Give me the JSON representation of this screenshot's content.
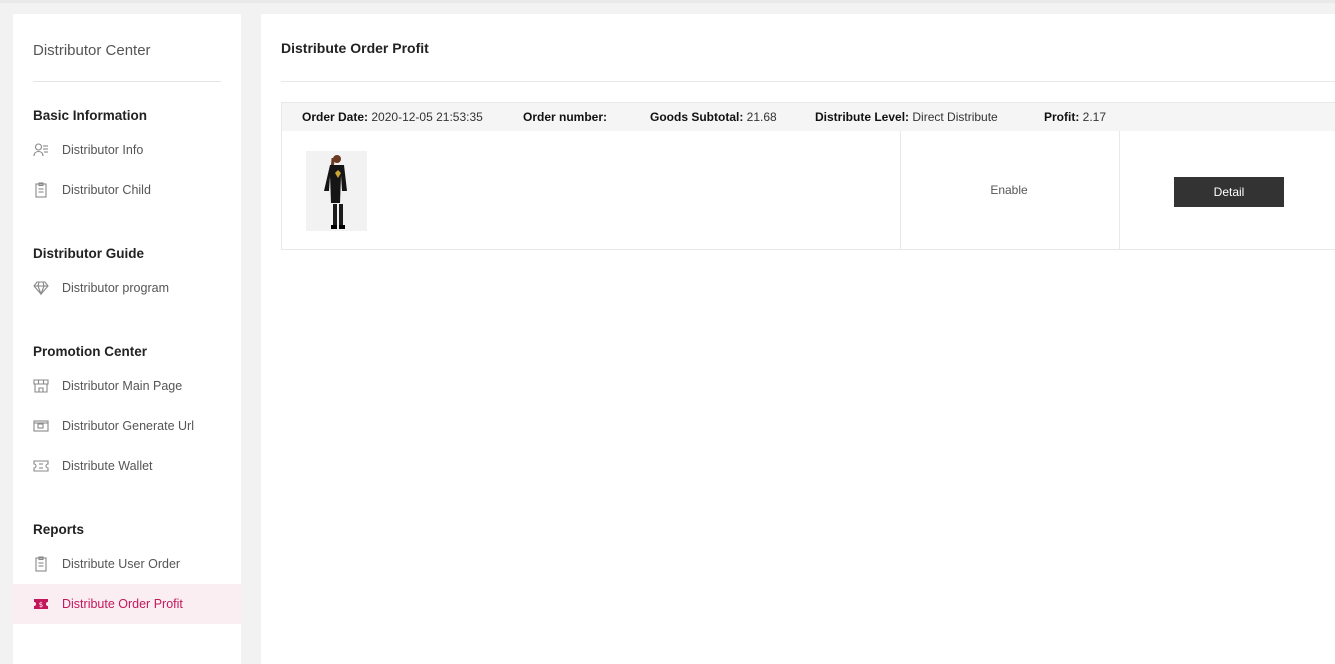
{
  "sidebar": {
    "title": "Distributor Center",
    "groups": [
      {
        "title": "Basic Information",
        "items": [
          {
            "label": "Distributor Info",
            "icon": "user-list-icon"
          },
          {
            "label": "Distributor Child",
            "icon": "clipboard-icon"
          }
        ]
      },
      {
        "title": "Distributor Guide",
        "items": [
          {
            "label": "Distributor program",
            "icon": "diamond-icon"
          }
        ]
      },
      {
        "title": "Promotion Center",
        "items": [
          {
            "label": "Distributor Main Page",
            "icon": "store-icon"
          },
          {
            "label": "Distributor Generate Url",
            "icon": "wallet-card-icon"
          },
          {
            "label": "Distribute Wallet",
            "icon": "ticket-icon"
          }
        ]
      },
      {
        "title": "Reports",
        "items": [
          {
            "label": "Distribute User Order",
            "icon": "clipboard-icon"
          },
          {
            "label": "Distribute Order Profit",
            "icon": "dollar-ticket-icon",
            "active": true
          }
        ]
      }
    ]
  },
  "main": {
    "title": "Distribute Order Profit",
    "order": {
      "date_key": "Order Date:",
      "date_value": "2020-12-05 21:53:35",
      "number_key": "Order number:",
      "number_value": "",
      "subtotal_key": "Goods Subtotal:",
      "subtotal_value": "21.68",
      "level_key": "Distribute Level:",
      "level_value": "Direct Distribute",
      "profit_key": "Profit:",
      "profit_value": "2.17",
      "status": "Enable",
      "detail_label": "Detail"
    }
  },
  "colors": {
    "accent": "#c2185b",
    "active_bg": "#fbeef2",
    "button_bg": "#333333"
  }
}
